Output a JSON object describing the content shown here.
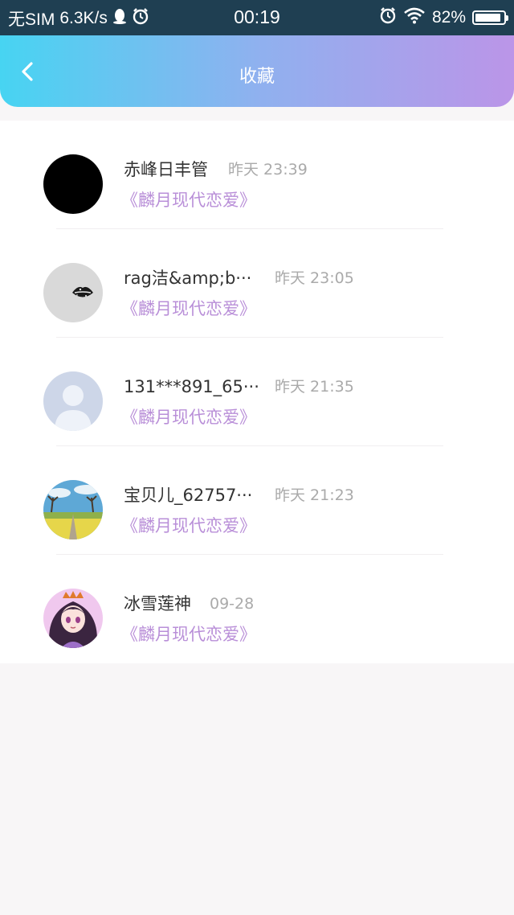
{
  "status_bar": {
    "carrier": "无SIM",
    "speed": "6.3K/s",
    "time": "00:19",
    "battery": "82%"
  },
  "header": {
    "title": "收藏",
    "back_icon": "chevron-left-icon"
  },
  "favorites": [
    {
      "name": "赤峰日丰管",
      "time": "昨天 23:39",
      "title": "《麟月现代恋爱》",
      "avatar": "black-avatar"
    },
    {
      "name": "rag洁&amp;b···",
      "time": "昨天 23:05",
      "title": "《麟月现代恋爱》",
      "avatar": "lips-avatar"
    },
    {
      "name": "131***891_65···",
      "time": "昨天 21:35",
      "title": "《麟月现代恋爱》",
      "avatar": "default-person-avatar"
    },
    {
      "name": "宝贝儿_62757···",
      "time": "昨天 21:23",
      "title": "《麟月现代恋爱》",
      "avatar": "landscape-avatar"
    },
    {
      "name": "冰雪莲神",
      "time": "09-28",
      "title": "《麟月现代恋爱》",
      "avatar": "anime-girl-avatar"
    }
  ],
  "colors": {
    "header_gradient_start": "#47d4f2",
    "header_gradient_end": "#bb95e8",
    "title_link": "#b98fd8"
  }
}
